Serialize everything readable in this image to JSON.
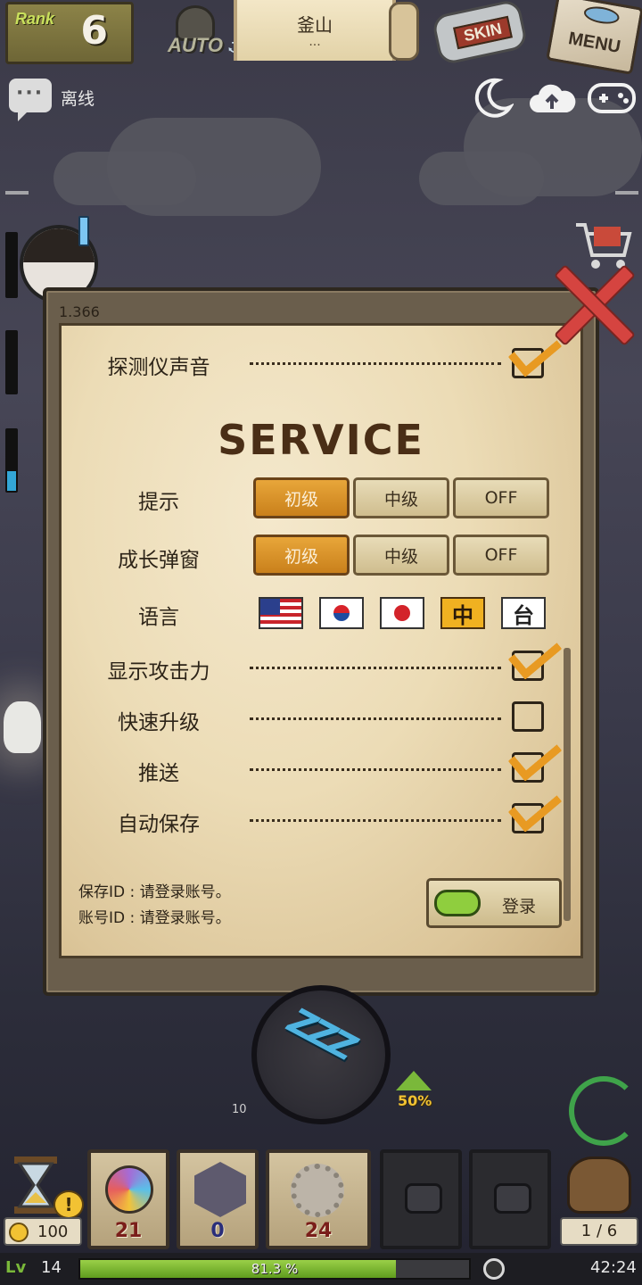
{
  "header": {
    "rank_label": "Rank",
    "rank_value": "6",
    "auto_label": "AUTO",
    "location_name": "釜山",
    "location_sub": "...",
    "skin_label": "SKIN",
    "menu_label": "MENU"
  },
  "status": {
    "connection": "离线"
  },
  "dialog": {
    "version": "1.366",
    "detector_sound_label": "探测仪声音",
    "detector_sound_checked": true,
    "section_title": "SERVICE",
    "hint": {
      "label": "提示",
      "options": [
        "初级",
        "中级",
        "OFF"
      ],
      "selected": "初级"
    },
    "growth_popup": {
      "label": "成长弹窗",
      "options": [
        "初级",
        "中级",
        "OFF"
      ],
      "selected": "初级"
    },
    "language": {
      "label": "语言",
      "flags": [
        {
          "icon": "us-flag-icon",
          "text": ""
        },
        {
          "icon": "kr-flag-icon",
          "text": ""
        },
        {
          "icon": "jp-flag-icon",
          "text": ""
        },
        {
          "icon": "zh-flag-icon",
          "text": "中"
        },
        {
          "icon": "tw-flag-icon",
          "text": "台"
        }
      ],
      "selected": "中"
    },
    "toggles": [
      {
        "label": "显示攻击力",
        "checked": true
      },
      {
        "label": "快速升级",
        "checked": false
      },
      {
        "label": "推送",
        "checked": true
      },
      {
        "label": "自动保存",
        "checked": true
      }
    ],
    "save_id_line": "保存ID : 请登录账号。",
    "account_id_line": "账号ID : 请登录账号。",
    "login_label": "登录"
  },
  "hud": {
    "speed_tick": "10",
    "boost_percent": "50%",
    "coin_value": "100",
    "hourglass_badge": "!",
    "slots": [
      {
        "icon": "orb-icon",
        "count": "21"
      },
      {
        "icon": "shield-icon",
        "count": "0"
      },
      {
        "icon": "gear-icon",
        "count": "24"
      },
      {
        "icon": "lock-icon",
        "count": ""
      },
      {
        "icon": "lock-icon",
        "count": ""
      }
    ],
    "bag_count": "1 / 6",
    "level_label": "Lv",
    "level_value": "14",
    "xp_percent_label": "81.3 %",
    "xp_fraction": 0.813,
    "time": "42:24"
  },
  "colors": {
    "accent_orange": "#e89a22",
    "paper": "#ecdcb6",
    "close_red": "#d54440"
  }
}
